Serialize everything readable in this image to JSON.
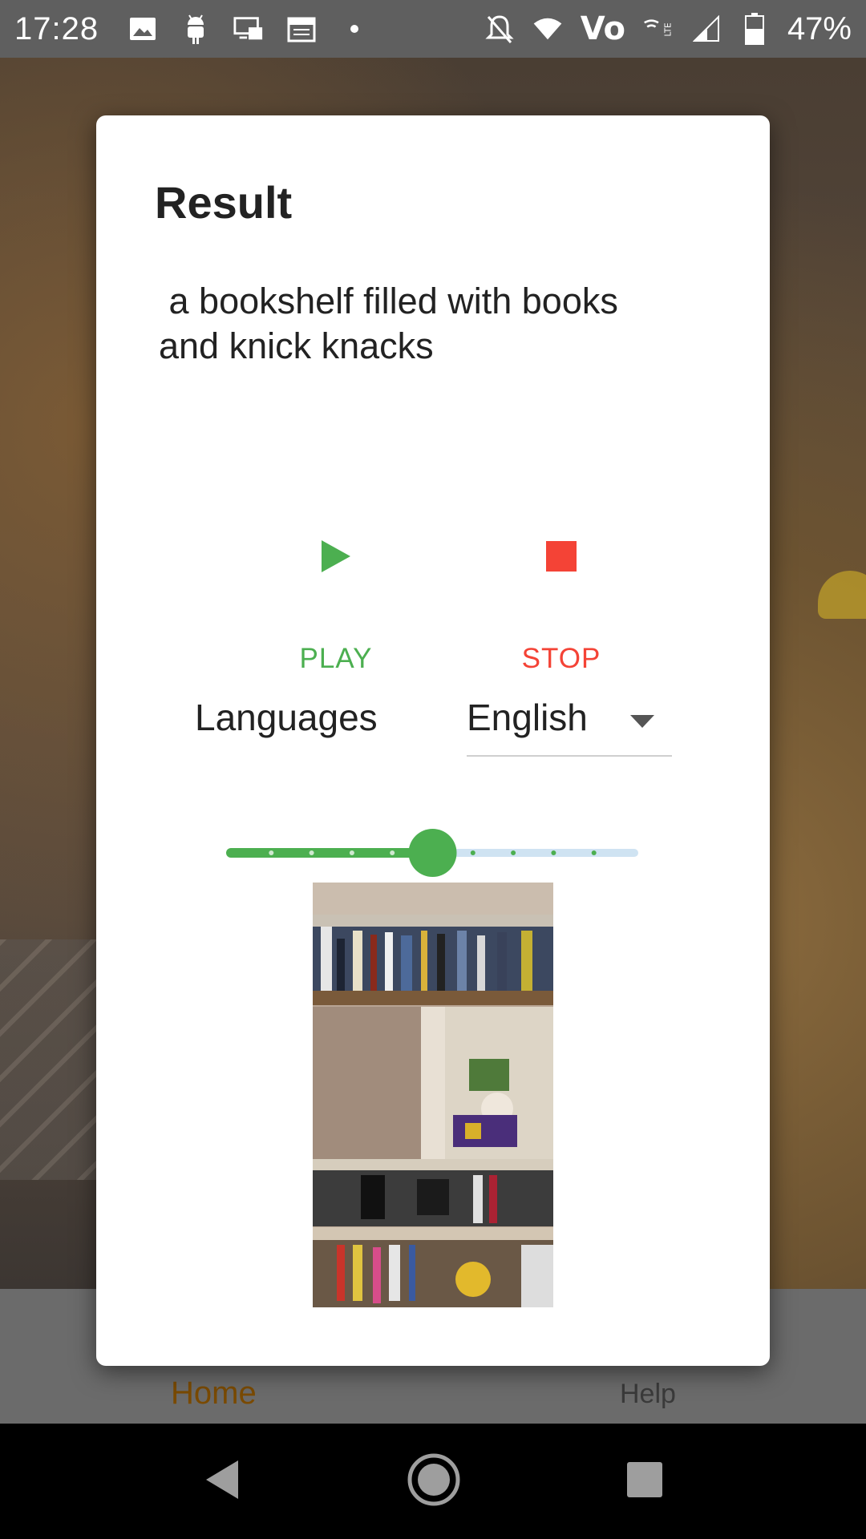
{
  "status_bar": {
    "time": "17:28",
    "left_icons": [
      "image-icon",
      "android-icon",
      "cast-screen-icon",
      "calendar-icon",
      "dot-icon"
    ],
    "battery": "47%",
    "volte": "Vo"
  },
  "dialog": {
    "title": "Result",
    "caption": " a bookshelf filled with books\nand knick knacks",
    "play_label": "PLAY",
    "stop_label": "STOP",
    "languages_label": "Languages",
    "language_value": "English",
    "slider": {
      "steps": 10,
      "value": 5
    }
  },
  "app_nav": {
    "home_label": "Home",
    "help_label": "Help"
  },
  "colors": {
    "play": "#4caf50",
    "stop": "#f44336",
    "slider_track_inactive": "#cfe3f2",
    "home_text": "#7a4a00"
  }
}
